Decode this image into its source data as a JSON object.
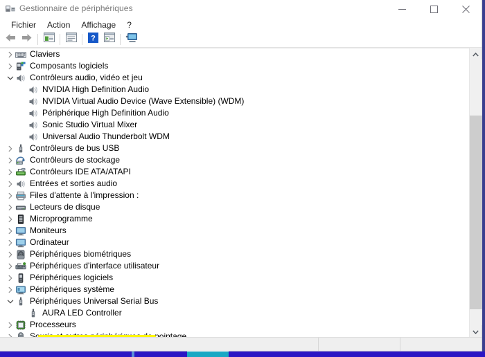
{
  "window": {
    "title": "Gestionnaire de périphériques",
    "title_icon": "device-manager-icon",
    "caption": {
      "minimize_label": "Réduire",
      "maximize_label": "Agrandir",
      "close_label": "Fermer"
    }
  },
  "menubar": {
    "items": [
      {
        "label": "Fichier",
        "name": "menu-fichier"
      },
      {
        "label": "Action",
        "name": "menu-action"
      },
      {
        "label": "Affichage",
        "name": "menu-affichage"
      },
      {
        "label": "?",
        "name": "menu-aide"
      }
    ]
  },
  "toolbar": {
    "buttons": [
      {
        "name": "back-icon",
        "title": "Précédent"
      },
      {
        "name": "forward-icon",
        "title": "Suivant"
      },
      {
        "name": "show-hide-tree-icon",
        "title": "Afficher/Masquer l'arborescence"
      },
      {
        "name": "properties-icon",
        "title": "Propriétés"
      },
      {
        "name": "help-icon",
        "title": "Aide"
      },
      {
        "name": "update-driver-icon",
        "title": "Mettre à jour le pilote"
      },
      {
        "name": "scan-hardware-icon",
        "title": "Rechercher les modifications sur le matériel"
      }
    ]
  },
  "tree": {
    "nodes": [
      {
        "label": "Claviers",
        "icon": "keyboard-icon",
        "level": 0,
        "expander": "collapsed",
        "highlighted": false
      },
      {
        "label": "Composants logiciels",
        "icon": "software-component-icon",
        "level": 0,
        "expander": "collapsed",
        "highlighted": false
      },
      {
        "label": "Contrôleurs audio, vidéo et jeu",
        "icon": "speaker-icon",
        "level": 0,
        "expander": "expanded",
        "highlighted": false
      },
      {
        "label": "NVIDIA High Definition Audio",
        "icon": "speaker-icon",
        "level": 1,
        "expander": "none",
        "highlighted": false
      },
      {
        "label": "NVIDIA Virtual Audio Device (Wave Extensible) (WDM)",
        "icon": "speaker-icon",
        "level": 1,
        "expander": "none",
        "highlighted": false
      },
      {
        "label": "Périphérique High Definition Audio",
        "icon": "speaker-icon",
        "level": 1,
        "expander": "none",
        "highlighted": false
      },
      {
        "label": "Sonic Studio Virtual Mixer",
        "icon": "speaker-icon",
        "level": 1,
        "expander": "none",
        "highlighted": false
      },
      {
        "label": "Universal Audio Thunderbolt WDM",
        "icon": "speaker-icon",
        "level": 1,
        "expander": "none",
        "highlighted": false
      },
      {
        "label": "Contrôleurs de bus USB",
        "icon": "usb-icon",
        "level": 0,
        "expander": "collapsed",
        "highlighted": false
      },
      {
        "label": "Contrôleurs de stockage",
        "icon": "storage-controller-icon",
        "level": 0,
        "expander": "collapsed",
        "highlighted": false
      },
      {
        "label": "Contrôleurs IDE ATA/ATAPI",
        "icon": "ide-controller-icon",
        "level": 0,
        "expander": "collapsed",
        "highlighted": false
      },
      {
        "label": "Entrées et sorties audio",
        "icon": "speaker-icon",
        "level": 0,
        "expander": "collapsed",
        "highlighted": false
      },
      {
        "label": "Files d'attente à l'impression :",
        "icon": "printer-icon",
        "level": 0,
        "expander": "collapsed",
        "highlighted": false
      },
      {
        "label": "Lecteurs de disque",
        "icon": "disk-drive-icon",
        "level": 0,
        "expander": "collapsed",
        "highlighted": false
      },
      {
        "label": "Microprogramme",
        "icon": "firmware-icon",
        "level": 0,
        "expander": "collapsed",
        "highlighted": false
      },
      {
        "label": "Moniteurs",
        "icon": "monitor-icon",
        "level": 0,
        "expander": "collapsed",
        "highlighted": false
      },
      {
        "label": "Ordinateur",
        "icon": "monitor-icon",
        "level": 0,
        "expander": "collapsed",
        "highlighted": false
      },
      {
        "label": "Périphériques biométriques",
        "icon": "fingerprint-icon",
        "level": 0,
        "expander": "collapsed",
        "highlighted": false
      },
      {
        "label": "Périphériques d'interface utilisateur",
        "icon": "hid-icon",
        "level": 0,
        "expander": "collapsed",
        "highlighted": false
      },
      {
        "label": "Périphériques logiciels",
        "icon": "software-device-icon",
        "level": 0,
        "expander": "collapsed",
        "highlighted": false
      },
      {
        "label": "Périphériques système",
        "icon": "system-device-icon",
        "level": 0,
        "expander": "collapsed",
        "highlighted": false
      },
      {
        "label": "Périphériques Universal Serial Bus",
        "icon": "usb-icon",
        "level": 0,
        "expander": "expanded",
        "highlighted": true
      },
      {
        "label": "AURA LED Controller",
        "icon": "usb-icon",
        "level": 1,
        "expander": "none",
        "highlighted": true
      },
      {
        "label": "Processeurs",
        "icon": "processor-icon",
        "level": 0,
        "expander": "collapsed",
        "highlighted": false
      },
      {
        "label": "Souris et autres périphériques de pointage",
        "icon": "mouse-icon",
        "level": 0,
        "expander": "collapsed",
        "highlighted": false
      }
    ]
  },
  "annotation": {
    "highlight_color": "#fff600",
    "highlighted_items": [
      "Périphériques Universal Serial Bus",
      "AURA LED Controller"
    ]
  },
  "scrollbar": {
    "up_arrow": "scroll-up-icon",
    "down_arrow": "scroll-down-icon",
    "thumb_top_pct": 21,
    "thumb_height_pct": 73
  },
  "statusbar": {
    "cells": [
      "",
      "",
      ""
    ]
  },
  "taskbar": {
    "background_color": "#2b16c4",
    "active_item_color": "#18a8c4"
  }
}
